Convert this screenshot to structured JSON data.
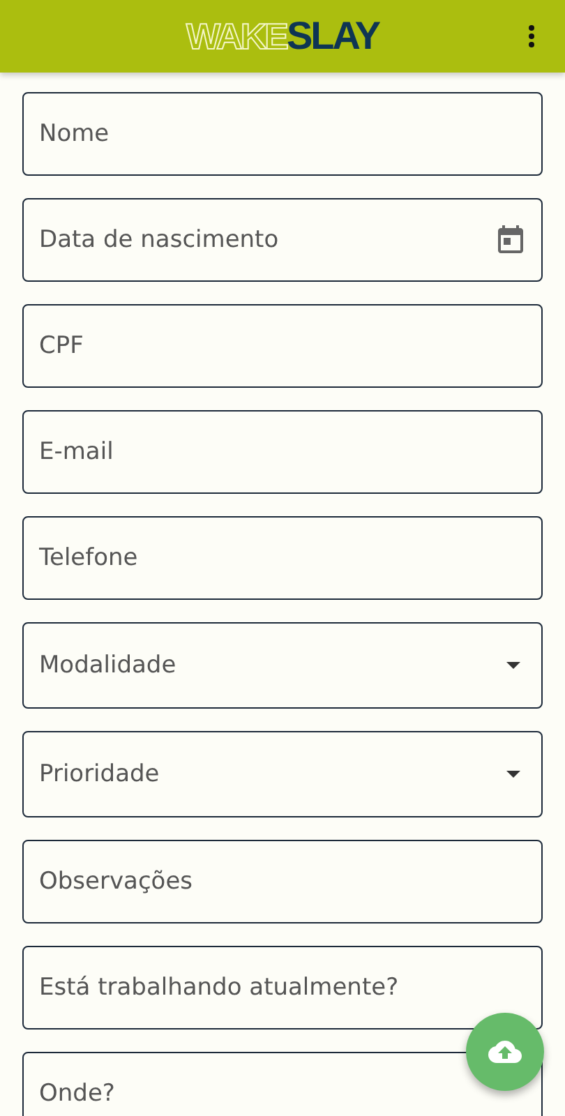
{
  "app_bar": {
    "logo_outline": "WAKE",
    "logo_solid": "SLAY"
  },
  "fields": [
    {
      "kind": "text",
      "placeholder": "Nome"
    },
    {
      "kind": "date",
      "placeholder": "Data de nascimento"
    },
    {
      "kind": "text",
      "placeholder": "CPF"
    },
    {
      "kind": "text",
      "placeholder": "E-mail"
    },
    {
      "kind": "text",
      "placeholder": "Telefone"
    },
    {
      "kind": "select",
      "placeholder": "Modalidade"
    },
    {
      "kind": "select",
      "placeholder": "Prioridade"
    },
    {
      "kind": "text",
      "placeholder": "Observações"
    },
    {
      "kind": "text",
      "placeholder": "Está trabalhando atualmente?"
    },
    {
      "kind": "text",
      "placeholder": "Onde?"
    }
  ]
}
